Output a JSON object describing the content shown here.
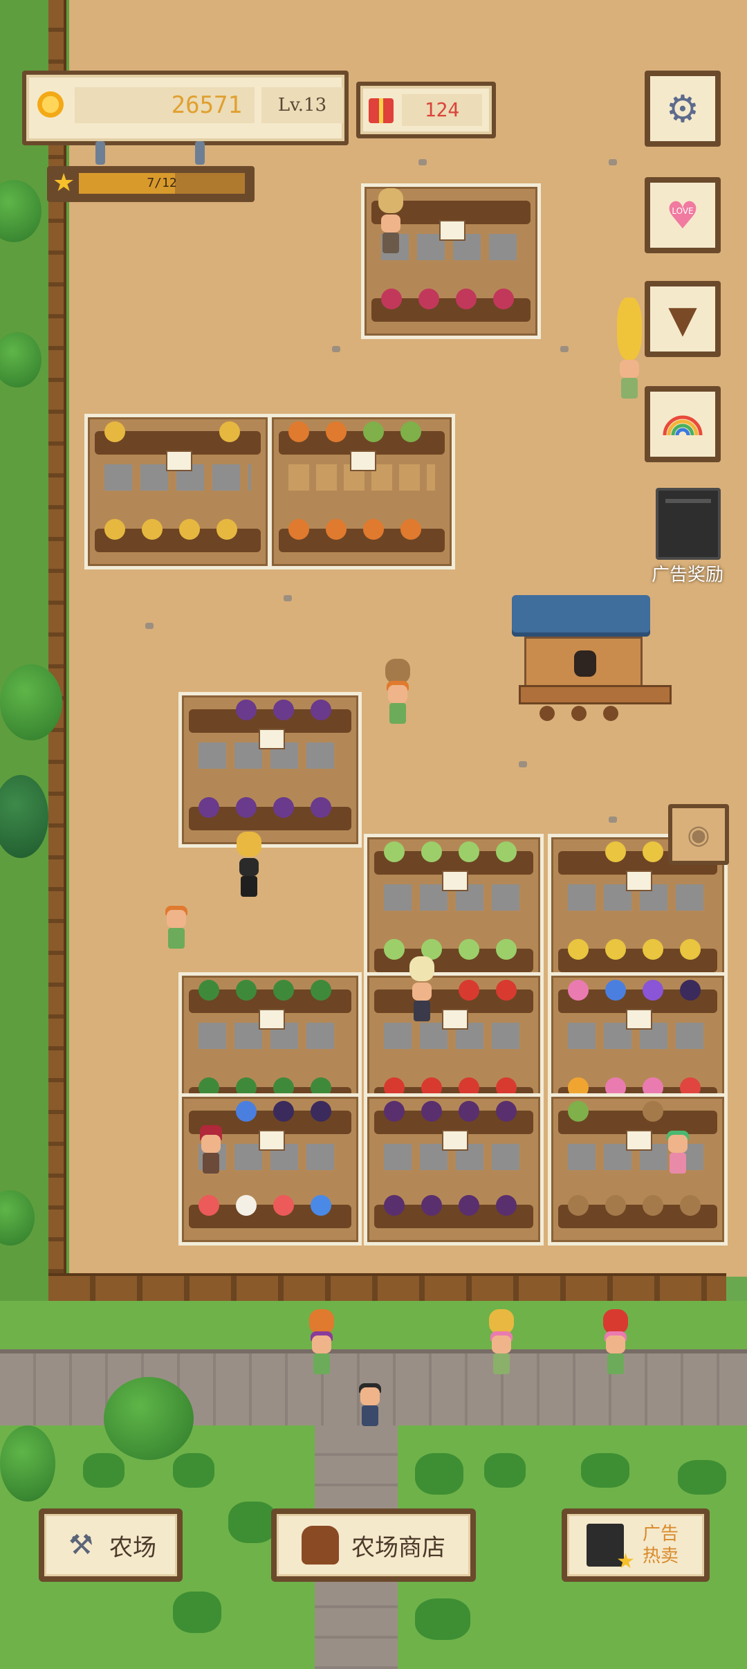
{
  "hud": {
    "gold": "26571",
    "level": "Lv.13",
    "gifts": "124",
    "xp": {
      "text": "7/12",
      "fraction": 0.58
    }
  },
  "side_buttons": {
    "settings_icon": "gear-icon",
    "love_icon": "heart-icon",
    "love_text": "LOVE",
    "cone_icon": "ice-cream-icon",
    "rainbow_icon": "rainbow-icon",
    "ad_reward_label": "广告奖励",
    "view_icon": "eye-icon"
  },
  "bottom_bar": {
    "farm_label": "农场",
    "shop_label": "农场商店",
    "ad_label": "广告\n热卖"
  },
  "colors": {
    "dirt": "#d9b07a",
    "grass": "#6fb24a",
    "panel": "#f5e9cc",
    "panel_border": "#6b4a2c",
    "gold_text": "#e0a030",
    "gift_text": "#d8453b"
  }
}
